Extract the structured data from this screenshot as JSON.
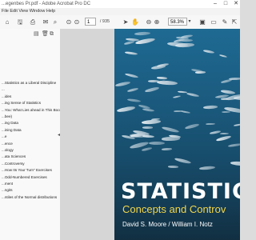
{
  "window": {
    "title": "...egenbes Pr.pdf - Adobe Acrobat Pro DC",
    "controls": [
      "–",
      "□",
      "✕"
    ]
  },
  "menubar": {
    "items": "File Edit View Window Help"
  },
  "toolbar": {
    "page_number": "1",
    "page_total": "/ 935",
    "zoom": "58.3%"
  },
  "bookmarks": [
    {
      "label": "...Statistics as a Liberal Discipline",
      "indent": false
    },
    {
      "label": "...",
      "indent": false
    },
    {
      "label": "...ides",
      "indent": false
    },
    {
      "label": "...ing Sense of Statistics",
      "indent": false
    },
    {
      "label": "...You: What Lies ahead in This Book",
      "indent": false
    },
    {
      "label": "...bee)",
      "indent": false
    },
    {
      "label": "...ing Data",
      "indent": false
    },
    {
      "label": "...ining Data",
      "indent": false
    },
    {
      "label": "...e",
      "indent": false
    },
    {
      "label": "...ence",
      "indent": false
    },
    {
      "label": "...ology",
      "indent": false
    },
    {
      "label": "...ata Sciences",
      "indent": false
    },
    {
      "label": "...Controversy",
      "indent": false
    },
    {
      "label": "...How Its Your Turn\" Exercises",
      "indent": false
    },
    {
      "label": "...Odd-Numbered Exercises",
      "indent": false
    },
    {
      "label": "...ment",
      "indent": false
    },
    {
      "label": "...ngits",
      "indent": false
    },
    {
      "label": "...ntiles of the Normal distributions",
      "indent": false
    }
  ],
  "cover": {
    "title": "STATISTIC",
    "subtitle": "Concepts and Controv",
    "authors": "David S. Moore / William I. Notz"
  }
}
